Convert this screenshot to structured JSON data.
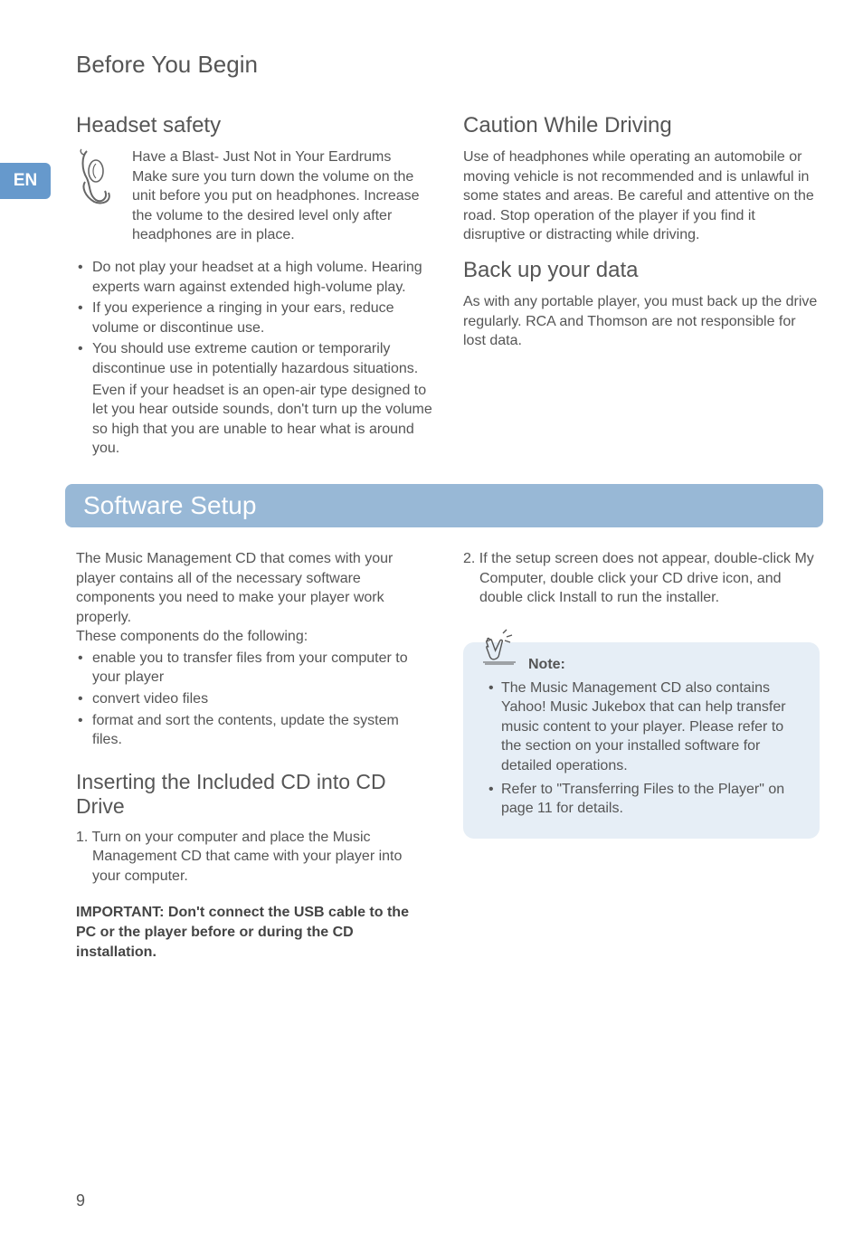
{
  "header": {
    "title": "Before You Begin",
    "lang_badge": "EN"
  },
  "col_left_top": {
    "section_title": "Headset safety",
    "intro_line1": "Have a Blast- Just Not in Your Eardrums",
    "intro_line2": "Make sure you turn down the volume on the unit before you put on headphones. Increase the volume to the desired level only after headphones are in place.",
    "bullets": [
      "Do not play your headset at a high volume. Hearing experts warn against extended high-volume play.",
      "If you experience a ringing in your ears, reduce volume or discontinue use.",
      "You should use extreme caution or temporarily discontinue use in potentially hazardous situations."
    ],
    "trailing_para": "Even if your headset is an open-air type designed to let you hear outside sounds, don't turn up the volume so high that you are unable to hear what is around you."
  },
  "col_right_top": {
    "section1_title": "Caution While Driving",
    "section1_body": "Use of headphones while operating an automobile or moving vehicle is not recommended and is unlawful in some states and areas. Be careful and attentive on the road. Stop operation of the player if you find it disruptive or distracting while driving.",
    "section2_title": "Back up your data",
    "section2_body": "As with any portable player, you must back up the drive regularly. RCA and Thomson are not responsible for lost data."
  },
  "band": {
    "title": "Software Setup"
  },
  "col_left_bottom": {
    "intro_para": "The Music Management CD that comes with your player contains all of the necessary software components you need to make your player work properly.",
    "intro_para2": "These components do the following:",
    "bullets": [
      "enable you to transfer files from your computer to your player",
      "convert video files",
      "format and sort the contents, update the system files."
    ],
    "subsection_title": "Inserting the Included CD into CD Drive",
    "step1": "1. Turn on your computer and place the Music Management CD that came with your player into your computer.",
    "important": "IMPORTANT: Don't connect the USB cable to the PC or the player before or during the CD installation."
  },
  "col_right_bottom": {
    "step2": "2. If the setup screen does not appear, double-click My Computer, double click your CD drive icon, and double click Install to run the installer.",
    "note_label": "Note:",
    "note_bullets": [
      "The Music Management CD also contains Yahoo! Music Jukebox that can help transfer music content to your player. Please refer to the section on your installed software for detailed operations.",
      "Refer to \"Transferring Files to the Player\" on page 11 for details."
    ]
  },
  "page_number": "9"
}
